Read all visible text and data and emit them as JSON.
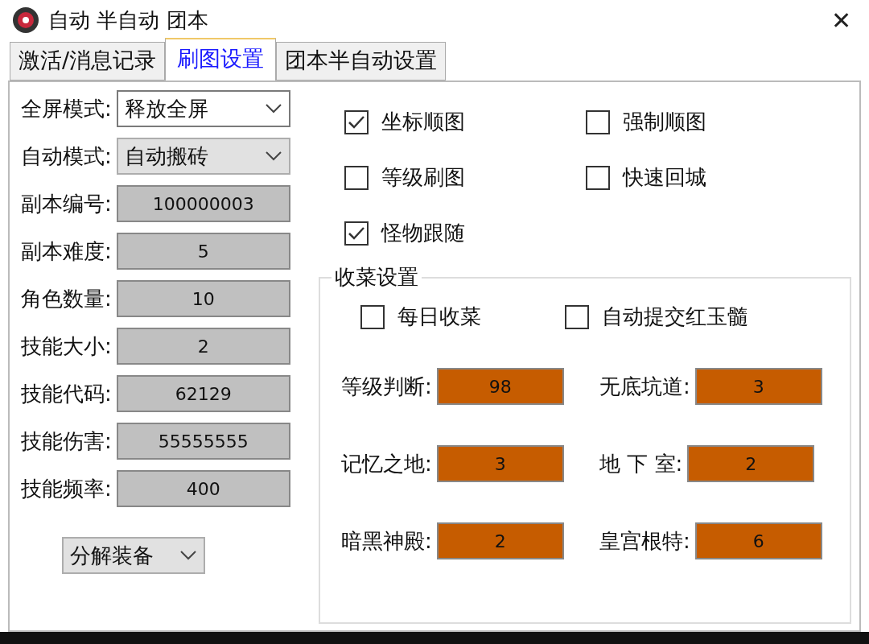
{
  "window": {
    "title": "自动 半自动 团本",
    "close": "✕"
  },
  "tabs": [
    {
      "label": "激活/消息记录",
      "selected": false
    },
    {
      "label": "刷图设置",
      "selected": true
    },
    {
      "label": "团本半自动设置",
      "selected": false
    }
  ],
  "left": {
    "dropdowns": [
      {
        "label": "全屏模式:",
        "value": "释放全屏",
        "kind": "edit"
      },
      {
        "label": "自动模式:",
        "value": "自动搬砖",
        "kind": "button"
      }
    ],
    "fields": [
      {
        "label": "副本编号:",
        "value": "100000003"
      },
      {
        "label": "副本难度:",
        "value": "5"
      },
      {
        "label": "角色数量:",
        "value": "10"
      },
      {
        "label": "技能大小:",
        "value": "2"
      },
      {
        "label": "技能代码:",
        "value": "62129"
      },
      {
        "label": "技能伤害:",
        "value": "55555555"
      },
      {
        "label": "技能频率:",
        "value": "400"
      }
    ],
    "bottom_dropdown": {
      "value": "分解装备"
    }
  },
  "options": [
    {
      "label": "坐标顺图",
      "checked": true
    },
    {
      "label": "强制顺图",
      "checked": false
    },
    {
      "label": "等级刷图",
      "checked": false
    },
    {
      "label": "快速回城",
      "checked": false
    },
    {
      "label": "怪物跟随",
      "checked": true
    }
  ],
  "harvest": {
    "title": "收菜设置",
    "options": [
      {
        "label": "每日收菜",
        "checked": false
      },
      {
        "label": "自动提交红玉髓",
        "checked": false
      }
    ],
    "fields": [
      {
        "label": "等级判断:",
        "value": "98"
      },
      {
        "label": "无底坑道:",
        "value": "3"
      },
      {
        "label": "记忆之地:",
        "value": "3"
      },
      {
        "label": "地 下 室:",
        "value": "2"
      },
      {
        "label": "暗黑神殿:",
        "value": "2"
      },
      {
        "label": "皇宫根特:",
        "value": "6"
      }
    ]
  }
}
